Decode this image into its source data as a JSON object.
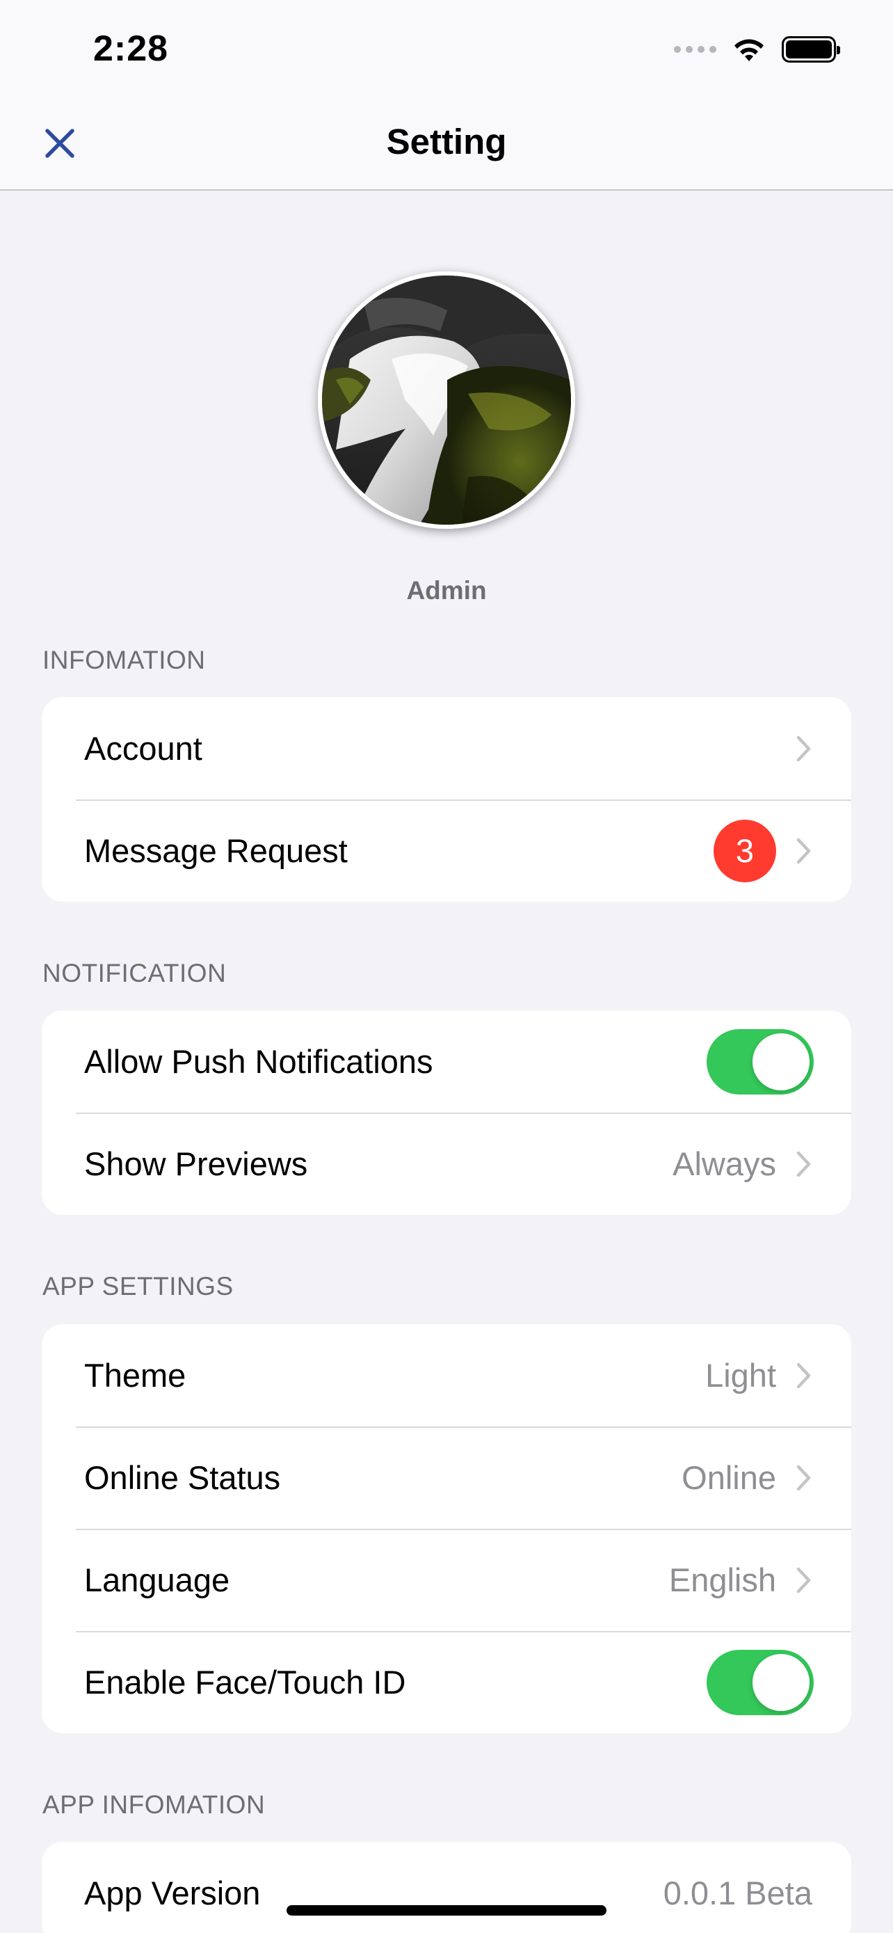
{
  "status_bar": {
    "time": "2:28",
    "icons": [
      "signal-icon",
      "wifi-icon",
      "battery-icon"
    ]
  },
  "nav": {
    "title": "Setting",
    "close_icon": "close-icon",
    "accent": "#2c4b9e"
  },
  "profile": {
    "name": "Admin"
  },
  "sections": {
    "infomation": {
      "header": "INFOMATION",
      "account": "Account",
      "message_request": "Message Request",
      "message_request_badge": "3"
    },
    "notification": {
      "header": "NOTIFICATION",
      "allow_push": "Allow Push Notifications",
      "allow_push_on": true,
      "show_previews": "Show Previews",
      "show_previews_value": "Always"
    },
    "app_settings": {
      "header": "APP SETTINGS",
      "theme": "Theme",
      "theme_value": "Light",
      "online_status": "Online Status",
      "online_status_value": "Online",
      "language": "Language",
      "language_value": "English",
      "face_id": "Enable Face/Touch ID",
      "face_id_on": true
    },
    "app_infomation": {
      "header": "APP INFOMATION",
      "app_version": "App Version",
      "app_version_value": "0.0.1 Beta"
    }
  },
  "colors": {
    "toggle_on": "#34c759",
    "badge": "#ff3b30",
    "background": "#f2f2f7"
  }
}
